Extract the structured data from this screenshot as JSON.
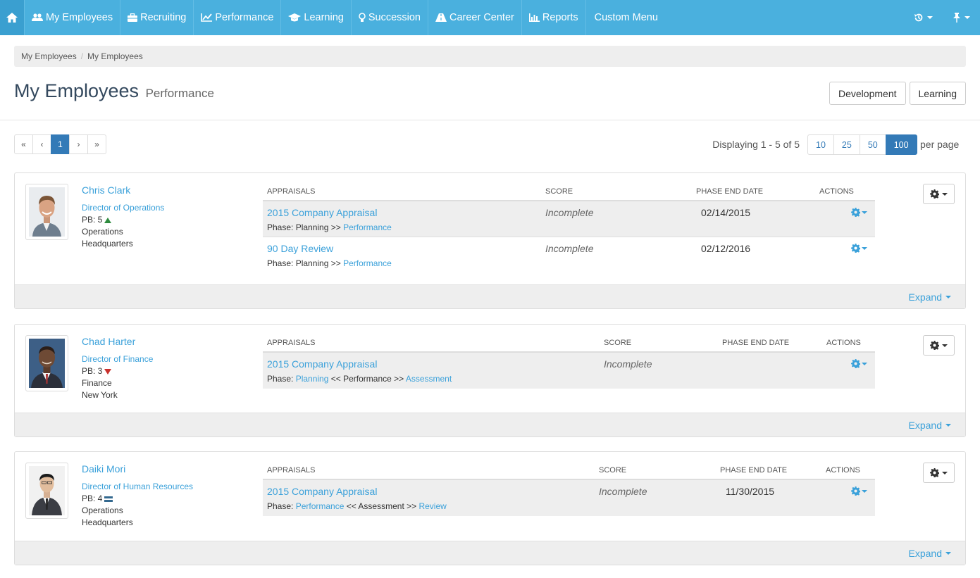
{
  "nav": {
    "items": [
      {
        "label": "My Employees",
        "icon": "users-icon"
      },
      {
        "label": "Recruiting",
        "icon": "briefcase-icon"
      },
      {
        "label": "Performance",
        "icon": "line-chart-icon"
      },
      {
        "label": "Learning",
        "icon": "graduation-cap-icon"
      },
      {
        "label": "Succession",
        "icon": "lightbulb-icon"
      },
      {
        "label": "Career Center",
        "icon": "road-icon"
      },
      {
        "label": "Reports",
        "icon": "bar-chart-icon"
      },
      {
        "label": "Custom Menu",
        "icon": ""
      }
    ],
    "accent": "#4ab0de"
  },
  "breadcrumb": [
    "My Employees",
    "My Employees"
  ],
  "header": {
    "title": "My Employees",
    "subtitle": "Performance",
    "buttons": [
      "Development",
      "Learning"
    ]
  },
  "pagination": {
    "first": "«",
    "prev": "‹",
    "current": "1",
    "next": "›",
    "last": "»",
    "display_text": "Displaying 1 - 5 of 5",
    "per_page_options": [
      "10",
      "25",
      "50",
      "100"
    ],
    "per_page_selected": "100",
    "per_page_label": "per page"
  },
  "columns": {
    "appraisals": "APPRAISALS",
    "score": "SCORE",
    "phase_end_date": "PHASE END DATE",
    "actions": "ACTIONS"
  },
  "expand_label": "Expand",
  "employees": [
    {
      "name": "Chris Clark",
      "title": "Director of Operations",
      "pb": "PB: 5",
      "pb_trend": "up",
      "department": "Operations",
      "location": "Headquarters",
      "appraisals": [
        {
          "name": "2015 Company Appraisal",
          "phase_prefix": "Phase: ",
          "phase_a": "Planning",
          "phase_sep1": " >> ",
          "phase_b": "Performance",
          "phase_sep2": "",
          "phase_c": "",
          "score": "Incomplete",
          "date": "02/14/2015"
        },
        {
          "name": "90 Day Review",
          "phase_prefix": "Phase: ",
          "phase_a": "Planning",
          "phase_sep1": " >> ",
          "phase_b": "Performance",
          "phase_sep2": "",
          "phase_c": "",
          "score": "Incomplete",
          "date": "02/12/2016"
        }
      ]
    },
    {
      "name": "Chad Harter",
      "title": "Director of Finance",
      "pb": "PB: 3",
      "pb_trend": "down",
      "department": "Finance",
      "location": "New York",
      "appraisals": [
        {
          "name": "2015 Company Appraisal",
          "phase_prefix": "Phase: ",
          "phase_a": "Planning",
          "phase_sep1": " << Performance >> ",
          "phase_b": "Assessment",
          "score": "Incomplete",
          "date": ""
        }
      ]
    },
    {
      "name": "Daiki Mori",
      "title": "Director of Human Resources",
      "pb": "PB: 4",
      "pb_trend": "flat",
      "department": "Operations",
      "location": "Headquarters",
      "appraisals": [
        {
          "name": "2015 Company Appraisal",
          "phase_prefix": "Phase: ",
          "phase_a": "Performance",
          "phase_sep1": " << Assessment >> ",
          "phase_b": "Review",
          "score": "Incomplete",
          "date": "11/30/2015"
        }
      ]
    }
  ]
}
